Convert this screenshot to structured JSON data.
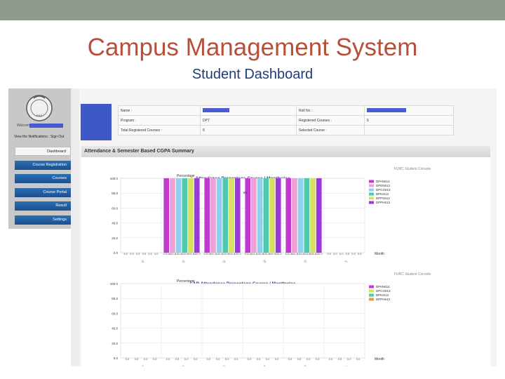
{
  "slide": {
    "title": "Campus Management System",
    "subtitle": "Student Dashboard"
  },
  "sidebar": {
    "welcome": "Welcome",
    "notifications_label": "View the Notifications",
    "sign_out_label": "Sign Out",
    "items": [
      {
        "label": "Dashboard",
        "active": true
      },
      {
        "label": "Course Registration",
        "active": false
      },
      {
        "label": "Courses",
        "active": false
      },
      {
        "label": "Course Portal",
        "active": false
      },
      {
        "label": "Result",
        "active": false
      },
      {
        "label": "Settings",
        "active": false
      }
    ],
    "logo_text": "PSS"
  },
  "info": {
    "name_label": "Name :",
    "roll_label": "Roll No :",
    "program_label": "Program :",
    "program_value": "DPT",
    "registered_label": "Registered Courses :",
    "registered_value": "6",
    "total_label": "Total Registered Courses :",
    "total_value": "6",
    "selected_label": "Selected Course :"
  },
  "panel": {
    "title": "Attendance & Semester Based CGPA Summary"
  },
  "colors": {
    "nav_blue": "#1b4f8c",
    "title_red": "#b5503a",
    "subtitle_blue": "#1f3c78",
    "redact": "#4a5bd0"
  },
  "chart_data": [
    {
      "type": "bar",
      "credit": "FURC Student Console",
      "title": "Attendance Percentage Course / Monthwise",
      "ylabel": "Percentage",
      "xlabel": "Month",
      "ylim": [
        0,
        100
      ],
      "yticks": [
        "100.0",
        "80.0",
        "60.0",
        "40.0",
        "20.0",
        "0.0"
      ],
      "categories": [
        "Sept",
        "October",
        "October",
        "November",
        "December",
        "January"
      ],
      "series": [
        {
          "name": "DPAN614",
          "color": "#c03ad0",
          "values": [
            0,
            100,
            100,
            100,
            100,
            0
          ]
        },
        {
          "name": "DPEN613",
          "color": "#f0a0d8",
          "values": [
            0,
            100,
            100,
            100,
            100,
            0
          ]
        },
        {
          "name": "DPCO613",
          "color": "#8fd0f0",
          "values": [
            0,
            100,
            100,
            100,
            100,
            0
          ]
        },
        {
          "name": "DPKI613",
          "color": "#50c8b0",
          "values": [
            0,
            100,
            100,
            100,
            100,
            0
          ]
        },
        {
          "name": "DPPS612",
          "color": "#d8e060",
          "values": [
            0,
            100,
            100,
            100,
            100,
            0
          ]
        },
        {
          "name": "DPPH613",
          "color": "#9b3ad8",
          "values": [
            0,
            100,
            100,
            100,
            100,
            0
          ]
        }
      ],
      "annotation": "86"
    },
    {
      "type": "bar",
      "credit": "FURC Student Console",
      "title": "LAB Attendance Percentage Course / Monthwise",
      "ylabel": "Percentage",
      "xlabel": "Month",
      "ylim": [
        0,
        100
      ],
      "yticks": [
        "100.0",
        "80.0",
        "60.0",
        "40.0",
        "20.0",
        "0.0"
      ],
      "categories": [
        "Sept",
        "October",
        "October",
        "November",
        "December",
        "January"
      ],
      "series": [
        {
          "name": "DPAN614",
          "color": "#c03ad0",
          "values": [
            0,
            0,
            0,
            0,
            0,
            0
          ]
        },
        {
          "name": "DPCO613",
          "color": "#d8e060",
          "values": [
            0,
            0,
            0,
            0,
            0,
            0
          ]
        },
        {
          "name": "DPKI613",
          "color": "#50c8b0",
          "values": [
            0,
            0,
            0,
            0,
            0,
            0
          ]
        },
        {
          "name": "DPPH613",
          "color": "#e0a040",
          "values": [
            0,
            0,
            0,
            0,
            0,
            0
          ]
        }
      ]
    }
  ]
}
